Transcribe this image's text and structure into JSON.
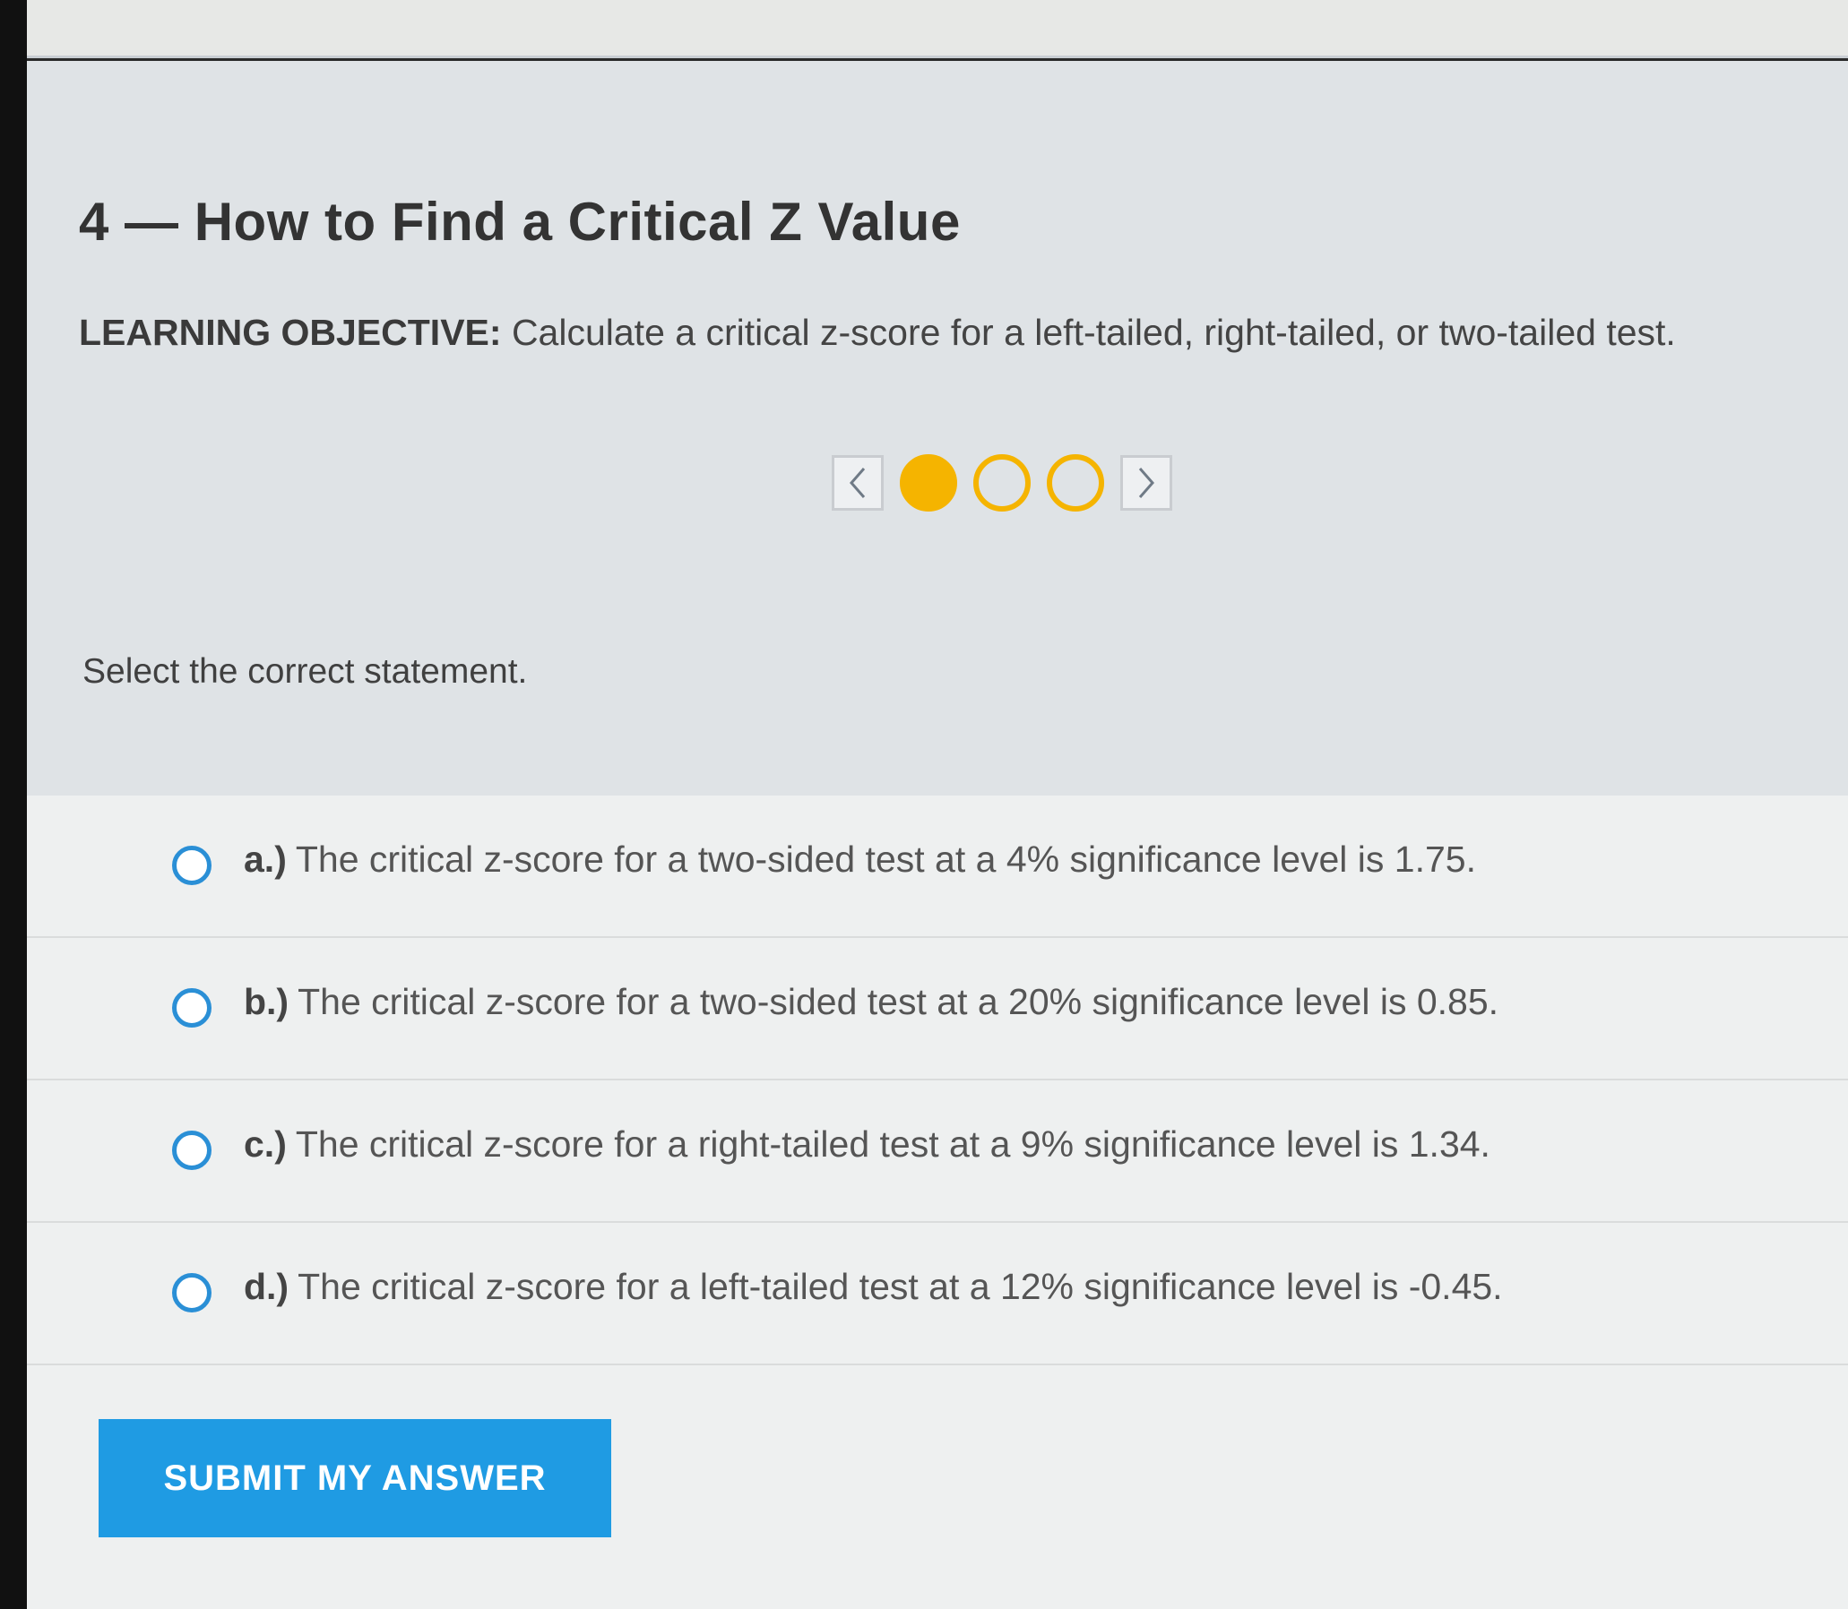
{
  "lesson": {
    "title": "4 — How to Find a Critical Z Value",
    "objective_label": "LEARNING OBJECTIVE:",
    "objective_text": "Calculate a critical z-score for a left-tailed, right-tailed, or two-tailed test."
  },
  "navigation": {
    "prev_icon": "chevron-left-icon",
    "next_icon": "chevron-right-icon",
    "total_steps": 3,
    "current_step": 1,
    "accent_color": "#f5b400"
  },
  "question": {
    "prompt": "Select the correct statement.",
    "options": [
      {
        "letter": "a.)",
        "text": "The critical z-score for a two-sided test at a 4% significance level is 1.75."
      },
      {
        "letter": "b.)",
        "text": "The critical z-score for a two-sided test at a 20% significance level is 0.85."
      },
      {
        "letter": "c.)",
        "text": "The critical z-score for a right-tailed test at a 9% significance level is 1.34."
      },
      {
        "letter": "d.)",
        "text": "The critical z-score for a left-tailed test at a 12% significance level is -0.45."
      }
    ]
  },
  "actions": {
    "submit_label": "SUBMIT MY ANSWER",
    "submit_color": "#1f9be3"
  },
  "colors": {
    "radio_border": "#2a8fd6",
    "header_bg": "#dfe3e6"
  }
}
